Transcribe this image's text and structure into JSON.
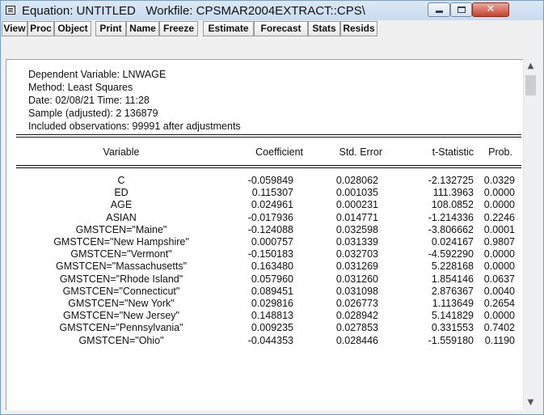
{
  "window": {
    "title_prefix": "Equation: UNTITLED",
    "workfile": "Workfile: CPSMAR2004EXTRACT::CPS\\",
    "controls": {
      "minimize": "minimize",
      "maximize": "maximize",
      "close": "✕"
    }
  },
  "toolbar": {
    "buttons": [
      "View",
      "Proc",
      "Object",
      "Print",
      "Name",
      "Freeze",
      "Estimate",
      "Forecast",
      "Stats",
      "Resids"
    ]
  },
  "output": {
    "dependent": "Dependent Variable: LNWAGE",
    "method": "Method: Least Squares",
    "date": "Date: 02/08/21   Time: 11:28",
    "sample": "Sample (adjusted): 2 136879",
    "included": "Included observations: 99991 after adjustments",
    "columns": [
      "Variable",
      "Coefficient",
      "Std. Error",
      "t-Statistic",
      "Prob."
    ],
    "rows": [
      [
        "C",
        "-0.059849",
        "0.028062",
        "-2.132725",
        "0.0329"
      ],
      [
        "ED",
        "0.115307",
        "0.001035",
        "111.3963",
        "0.0000"
      ],
      [
        "AGE",
        "0.024961",
        "0.000231",
        "108.0852",
        "0.0000"
      ],
      [
        "ASIAN",
        "-0.017936",
        "0.014771",
        "-1.214336",
        "0.2246"
      ],
      [
        "GMSTCEN=\"Maine\"",
        "-0.124088",
        "0.032598",
        "-3.806662",
        "0.0001"
      ],
      [
        "GMSTCEN=\"New Hampshire\"",
        "0.000757",
        "0.031339",
        "0.024167",
        "0.9807"
      ],
      [
        "GMSTCEN=\"Vermont\"",
        "-0.150183",
        "0.032703",
        "-4.592290",
        "0.0000"
      ],
      [
        "GMSTCEN=\"Massachusetts\"",
        "0.163480",
        "0.031269",
        "5.228168",
        "0.0000"
      ],
      [
        "GMSTCEN=\"Rhode Island\"",
        "0.057960",
        "0.031260",
        "1.854146",
        "0.0637"
      ],
      [
        "GMSTCEN=\"Connecticut\"",
        "0.089451",
        "0.031098",
        "2.876367",
        "0.0040"
      ],
      [
        "GMSTCEN=\"New York\"",
        "0.029816",
        "0.026773",
        "1.113649",
        "0.2654"
      ],
      [
        "GMSTCEN=\"New Jersey\"",
        "0.148813",
        "0.028942",
        "5.141829",
        "0.0000"
      ],
      [
        "GMSTCEN=\"Pennsylvania\"",
        "0.009235",
        "0.027853",
        "0.331553",
        "0.7402"
      ],
      [
        "GMSTCEN=\"Ohio\"",
        "-0.044353",
        "0.028446",
        "-1.559180",
        "0.1190"
      ]
    ]
  },
  "icons": {
    "window_icon": "equation-window-icon",
    "scroll_up": "chevron-up-icon",
    "scroll_down": "chevron-down-icon"
  },
  "colors": {
    "titlebar": "#c9dbef",
    "close_button": "#c7422c"
  }
}
